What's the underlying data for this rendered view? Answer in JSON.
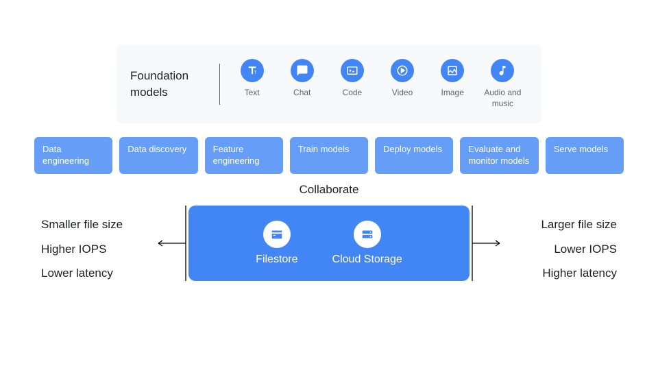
{
  "foundation": {
    "title": "Foundation models",
    "models": [
      {
        "name": "text",
        "label": "Text"
      },
      {
        "name": "chat",
        "label": "Chat"
      },
      {
        "name": "code",
        "label": "Code"
      },
      {
        "name": "video",
        "label": "Video"
      },
      {
        "name": "image",
        "label": "Image"
      },
      {
        "name": "audio",
        "label": "Audio and music"
      }
    ]
  },
  "pipeline": [
    "Data engineering",
    "Data discovery",
    "Feature engineering",
    "Train models",
    "Deploy models",
    "Evaluate and monitor models",
    "Serve models"
  ],
  "collaborate_label": "Collaborate",
  "storage": {
    "left_metrics": [
      "Smaller file size",
      "Higher IOPS",
      "Lower latency"
    ],
    "right_metrics": [
      "Larger file size",
      "Lower IOPS",
      "Higher latency"
    ],
    "products": [
      {
        "name": "filestore",
        "label": "Filestore"
      },
      {
        "name": "cloud-storage",
        "label": "Cloud Storage"
      }
    ]
  }
}
